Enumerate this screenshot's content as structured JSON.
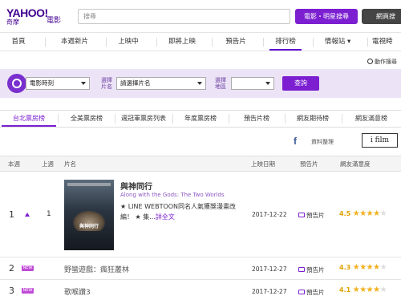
{
  "header": {
    "logo_brand": "YAHOO!",
    "logo_sub": "奇摩",
    "logo_section": "電影",
    "search_placeholder": "搜尋",
    "search_movie_label": "電影・明星搜尋",
    "search_web_label": "網頁搜"
  },
  "nav": {
    "items": [
      "首頁",
      "本週新片",
      "上映中",
      "即將上映",
      "預告片",
      "排行榜",
      "情報站",
      "電視時"
    ],
    "active": "排行榜",
    "dropdown_marker": "▾"
  },
  "advanced_search": "動作搜尋",
  "filter": {
    "cinema_select": "電影時刻",
    "movie_label": "選擇\n片名",
    "movie_select": "請選擇片名",
    "region_label": "選擇\n地區",
    "region_select": "",
    "query_button": "查詢"
  },
  "tabs": {
    "items": [
      "台北票房榜",
      "全美票房榜",
      "週冠軍票房列表",
      "年度票房榜",
      "預告片榜",
      "網友期待榜",
      "網友滿意榜"
    ],
    "active": "台北票房榜"
  },
  "source": {
    "facebook_icon": "f",
    "label": "資料整理",
    "logo": "i film"
  },
  "table": {
    "headers": [
      "本週",
      "上週",
      "片名",
      "上映日期",
      "預告片",
      "網友滿意度"
    ],
    "rows": [
      {
        "rank": "1",
        "trend": "up",
        "last_week": "1",
        "title_zh": "與神同行",
        "title_en": "Along with the Gods: The Two Worlds",
        "desc": "★ LINE WEBTOON同名人氣獲獎漫畫改編！ ★ 集...",
        "more": "詳全文",
        "poster_title": "與神同行",
        "release_date": "2017-12-22",
        "trailer": "預告片",
        "score": "4.5",
        "stars": 4.5
      },
      {
        "rank": "2",
        "badge": "NEW",
        "title_zh": "野蠻遊戲：瘋狂叢林",
        "release_date": "2017-12-27",
        "trailer": "預告片",
        "score": "4.3",
        "stars": 4.3
      },
      {
        "rank": "3",
        "badge": "NEW",
        "title_zh": "歌喉讚3",
        "release_date": "2017-12-27",
        "trailer": "預告片",
        "score": "4.1",
        "stars": 4.1
      }
    ]
  },
  "colors": {
    "accent": "#7b1fd1",
    "filter_bg": "#ece4f6",
    "new_badge": "#c04bd6",
    "star": "#f2b01e"
  }
}
